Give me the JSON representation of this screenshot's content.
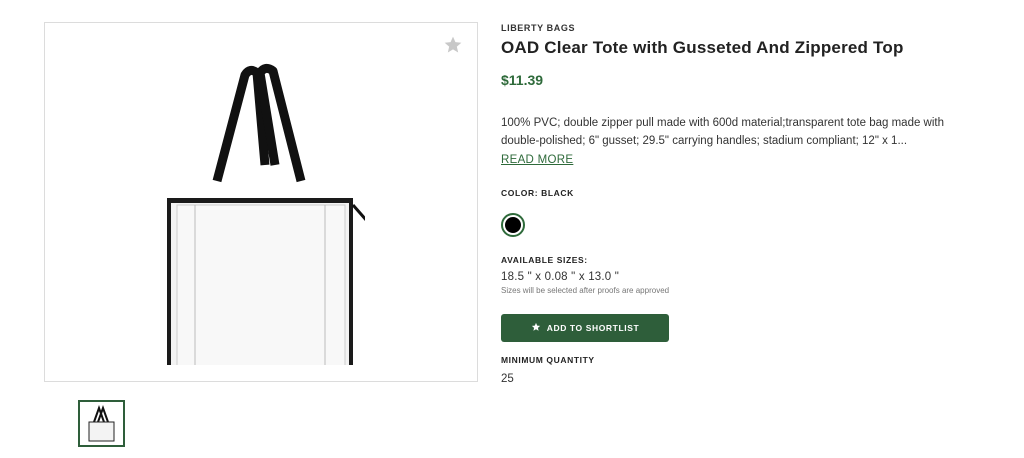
{
  "product": {
    "brand": "LIBERTY BAGS",
    "title": "OAD Clear Tote with Gusseted And Zippered Top",
    "price": "$11.39",
    "description": "100% PVC; double zipper pull made with 600d material;transparent tote bag made with double-polished; 6\" gusset; 29.5\" carrying handles; stadium compliant; 12\" x 1...",
    "read_more": "READ MORE",
    "color_label": "COLOR: BLACK",
    "color_swatch": "#000000",
    "sizes_label": "AVAILABLE SIZES:",
    "size_value": "18.5 \" x 0.08 \" x 13.0 \"",
    "size_note": "Sizes will be selected after proofs are approved",
    "shortlist_label": "ADD TO SHORTLIST",
    "min_qty_label": "MINIMUM QUANTITY",
    "min_qty_value": "25"
  },
  "colors": {
    "accent": "#2e6a3a",
    "button": "#2e5e3a"
  },
  "icons": {
    "favorite": "star-icon",
    "shortlist": "star-icon"
  }
}
